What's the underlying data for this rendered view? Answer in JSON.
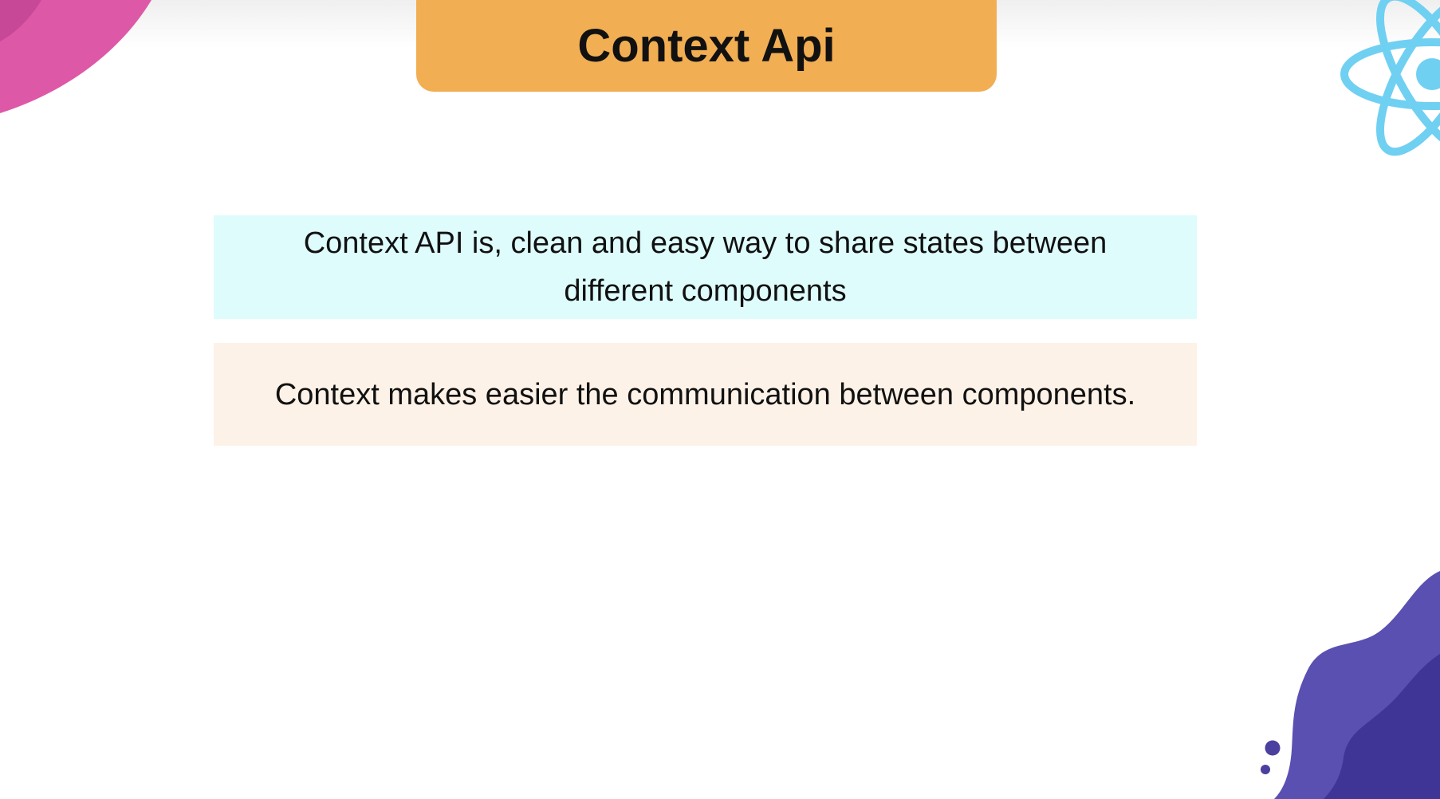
{
  "slide": {
    "title": "Context Api",
    "cards": [
      {
        "text": "Context API is, clean and easy way to share states between different components"
      },
      {
        "text": "Context makes easier the communication between components."
      }
    ]
  },
  "colors": {
    "title_bg": "#f2ae52",
    "card_1_bg": "#dffcfd",
    "card_2_bg": "#fdf2e7",
    "pink_shape": "#de58a8",
    "react_logo": "#6fd0f2",
    "purple_shape": "#4b3fa0"
  },
  "icons": {
    "top_left": "pink-blob-shape",
    "top_right": "react-logo-icon",
    "bottom_right": "purple-wave-shape"
  }
}
